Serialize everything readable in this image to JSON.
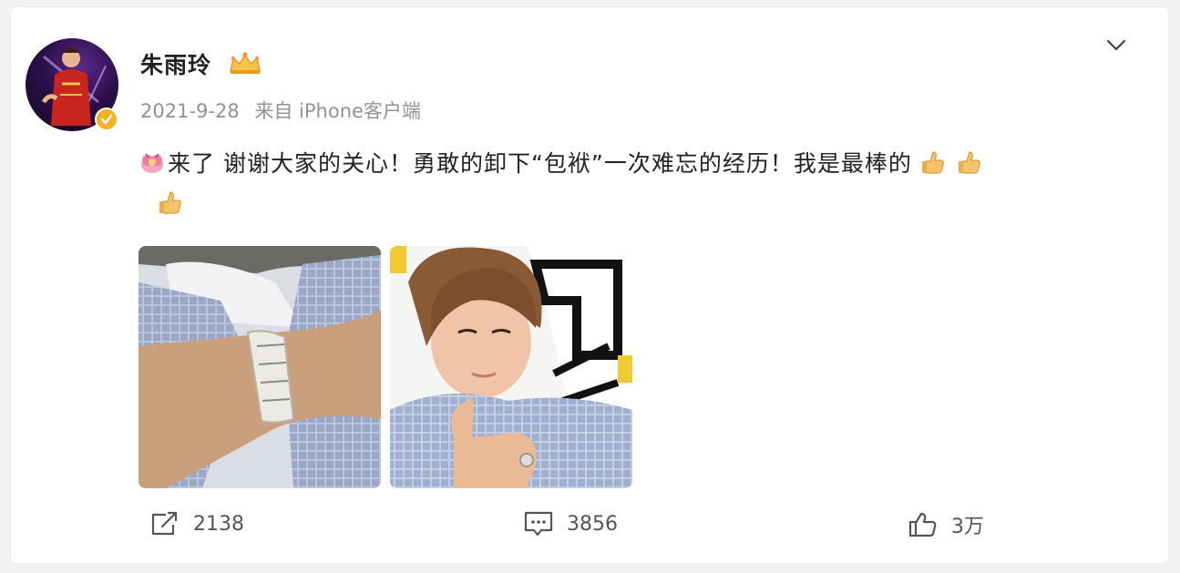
{
  "post": {
    "author": "朱雨玲",
    "date": "2021-9-28",
    "source": "来自 iPhone客户端",
    "text": "来了 谢谢大家的关心！勇敢的卸下“包袱”一次难忘的经历！我是最棒的",
    "icons": {
      "avatar": "avatar-image",
      "verified": "verified-badge-icon",
      "crown": "crown-icon",
      "menu": "chevron-down-icon",
      "leading_emoji": "flower-emoji-icon",
      "trailing_emoji": "thumbs-up-emoji-icon"
    },
    "images": [
      {
        "name": "wristband-photo"
      },
      {
        "name": "selfie-photo"
      }
    ]
  },
  "actions": {
    "repost_count": "2138",
    "comment_count": "3856",
    "like_count": "3万"
  },
  "colors": {
    "accent": "#f5b21b",
    "text": "#222222",
    "meta": "#939393",
    "action": "#555555"
  }
}
